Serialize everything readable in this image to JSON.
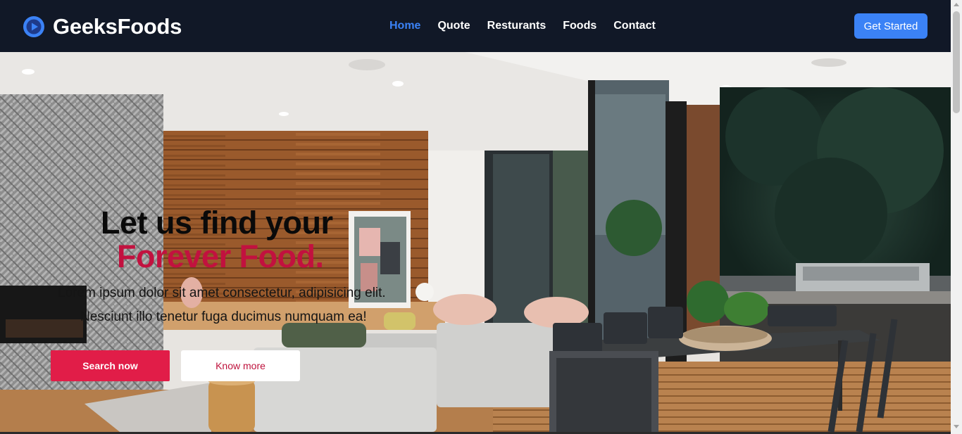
{
  "brand": {
    "name": "GeeksFoods",
    "icon": "play-circle-icon",
    "color": "#3b82f6"
  },
  "nav": {
    "items": [
      {
        "label": "Home",
        "active": true
      },
      {
        "label": "Quote",
        "active": false
      },
      {
        "label": "Resturants",
        "active": false
      },
      {
        "label": "Foods",
        "active": false
      },
      {
        "label": "Contact",
        "active": false
      }
    ],
    "cta_label": "Get Started"
  },
  "hero": {
    "heading_line1": "Let us find your",
    "heading_line2": "Forever Food.",
    "paragraph_line1": "Lorem ipsum dolor sit amet consectetur, adipisicing elit.",
    "paragraph_line2": "Nesciunt illo tenetur fuga ducimus numquam ea!",
    "primary_button": "Search now",
    "secondary_button": "Know more",
    "background": "modern-interior-dining-photo"
  },
  "colors": {
    "nav_bg": "#111827",
    "accent": "#3b82f6",
    "primary_button": "#e11d48",
    "heading_accent": "#c2113f"
  }
}
